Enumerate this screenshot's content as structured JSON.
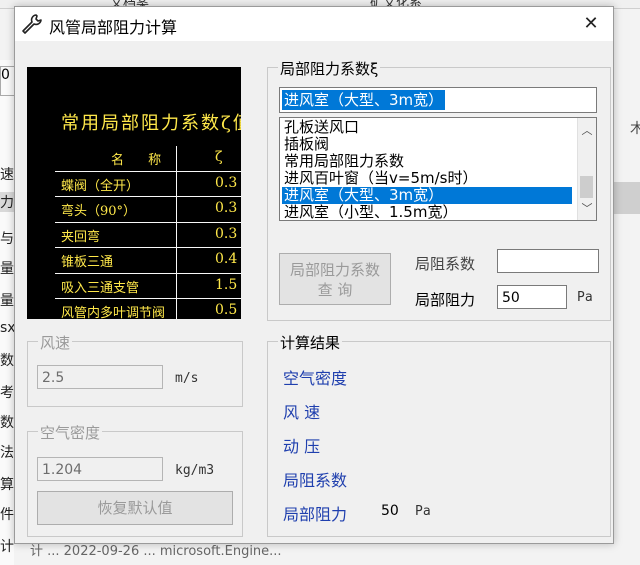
{
  "background": {
    "top_tabs": [
      "文档案",
      "矿文化系"
    ],
    "left_items": [
      "速",
      "力",
      "与",
      "量",
      "量",
      "sx",
      "数",
      "考",
      "数",
      "法",
      "算",
      "件",
      "计"
    ],
    "left_top_char": "0",
    "right_char": "木",
    "bottom_text": "计 ... 2022-09-26 ... microsoft.Engine..."
  },
  "dialog": {
    "title": "风管局部阻力计算",
    "close_label": "✕"
  },
  "image_panel": {
    "title": "常用局部阻力系数ζ值",
    "header": [
      "名 称",
      "ζ"
    ],
    "rows": [
      {
        "name": "蝶阀（全开）",
        "value": "0.3"
      },
      {
        "name": "弯头（90°）",
        "value": "0.3"
      },
      {
        "name": "夹回弯",
        "value": "0.3"
      },
      {
        "name": "锥板三通",
        "value": "0.4"
      },
      {
        "name": "吸入三通支管",
        "value": "1.5"
      },
      {
        "name": "风管内多叶调节阀",
        "value": "0.5"
      }
    ]
  },
  "coef_group": {
    "label": "局部阻力系数ξ",
    "selected_value": "进风室（大型、3m宽）",
    "list_items": [
      "孔板送风口",
      "插板阀",
      "常用局部阻力系数",
      "进风百叶窗（当v=5m/s时）",
      "进风室（大型、3m宽）",
      "进风室（小型、1.5m宽）"
    ],
    "selected_index": 4,
    "query_button": [
      "局部阻力系数",
      "查  询"
    ],
    "coef_label": "局阻系数",
    "coef_value": "",
    "resistance_label": "局部阻力",
    "resistance_value": "50",
    "resistance_unit": "Pa"
  },
  "wind_group": {
    "label": "风速",
    "value": "2.5",
    "unit": "m/s"
  },
  "density_group": {
    "label": "空气密度",
    "value": "1.204",
    "unit": "kg/m3",
    "reset_button": "恢复默认值"
  },
  "result_group": {
    "label": "计算结果",
    "items": [
      "空气密度",
      "风    速",
      "动    压",
      "局阻系数",
      "局部阻力"
    ],
    "resistance_value": "50",
    "resistance_unit": "Pa"
  }
}
